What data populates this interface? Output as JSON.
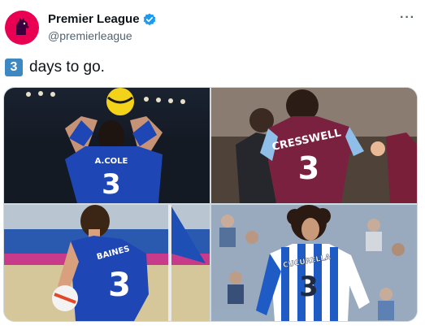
{
  "tweet": {
    "display_name": "Premier League",
    "handle": "@premierleague",
    "more_icon": "more-dots-icon",
    "verified_icon": "verified-badge-icon",
    "text": "days to go.",
    "keycap": "3"
  },
  "media": [
    {
      "name": "A.COLE",
      "number": "3"
    },
    {
      "name": "CRESSWELL",
      "number": "3"
    },
    {
      "name": "BAINES",
      "number": "3"
    },
    {
      "name": "CUCURELLA",
      "number": "3"
    }
  ],
  "colors": {
    "brand": "#e90052",
    "verified": "#1d9bf0",
    "keycap": "#3b88c3",
    "secondary_text": "#536471"
  }
}
